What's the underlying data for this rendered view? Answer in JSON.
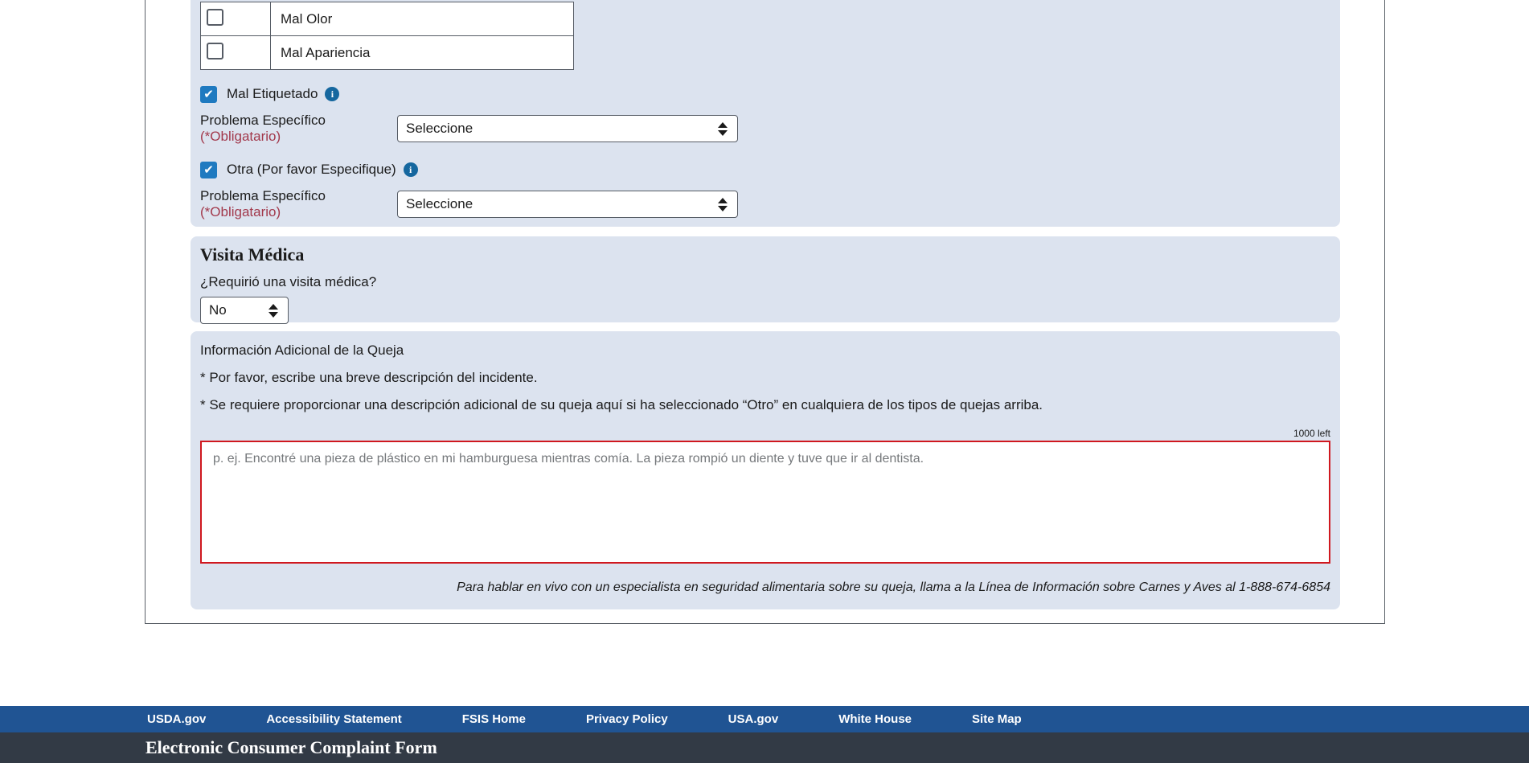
{
  "complaint_types": {
    "table_options": [
      {
        "label": "Mal Olor",
        "checked": false
      },
      {
        "label": "Mal Apariencia",
        "checked": false
      }
    ],
    "groups": [
      {
        "label": "Mal Etiquetado",
        "checked": true,
        "problem_label": "Problema Específico ",
        "required_note": "(*Obligatario)",
        "select_value": "Seleccione"
      },
      {
        "label": "Otra (Por favor Especifique)",
        "checked": true,
        "problem_label": "Problema Específico ",
        "required_note": "(*Obligatario)",
        "select_value": "Seleccione"
      }
    ],
    "info_icon": "i"
  },
  "medical_visit": {
    "title": "Visita Médica",
    "question": "¿Requirió una visita médica?",
    "select_value": "No"
  },
  "additional_info": {
    "title": "Información Adicional de la Queja",
    "line1": "* Por favor, escribe una breve descripción del incidente.",
    "line2": "* Se requiere proporcionar una descripción adicional de su queja aquí si ha seleccionado “Otro” en cualquiera de los tipos de quejas arriba.",
    "chars_left": "1000 left",
    "textarea_value": "",
    "textarea_placeholder": "p. ej. Encontré una pieza de plástico en mi hamburguesa mientras comía. La pieza rompió un diente y tuve que ir al dentista.",
    "hotline_note": "Para hablar en vivo con un especialista en seguridad alimentaria sobre su queja, llama a la Línea de Información sobre Carnes y Aves al 1-888-674-6854"
  },
  "footer": {
    "links": [
      "USDA.gov",
      "Accessibility Statement",
      "FSIS Home",
      "Privacy Policy",
      "USA.gov",
      "White House",
      "Site Map"
    ],
    "title": "Electronic Consumer Complaint Form"
  },
  "colors": {
    "panel_bg": "#dce3ef",
    "checkbox_checked": "#1f7ac0",
    "info_icon_bg": "#15679f",
    "required_red": "#a2394c",
    "textarea_error_border": "#d0181f",
    "footer_nav_bg": "#205493",
    "footer_band_bg": "#323a45",
    "border_gray": "#565c65"
  }
}
